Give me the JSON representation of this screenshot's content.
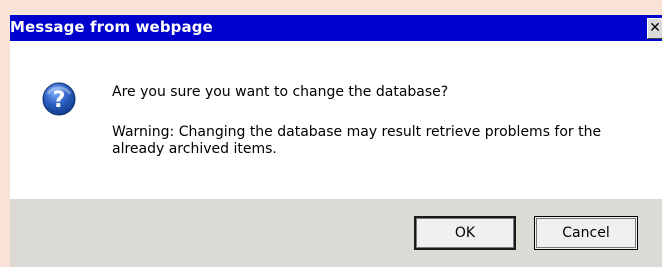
{
  "window": {
    "title": "Message from webpage",
    "close_glyph": "✕"
  },
  "message": {
    "icon": "question-icon",
    "main": "Are you sure you want to change the database?",
    "warning": "Warning: Changing the database may result retrieve problems for the already archived items."
  },
  "buttons": {
    "ok_label": "OK",
    "cancel_label": "Cancel"
  },
  "colors": {
    "titlebar": "#0000cc",
    "frame": "#f9e3d9",
    "footer": "#dcdad5",
    "icon_blue": "#2a5fc0"
  }
}
